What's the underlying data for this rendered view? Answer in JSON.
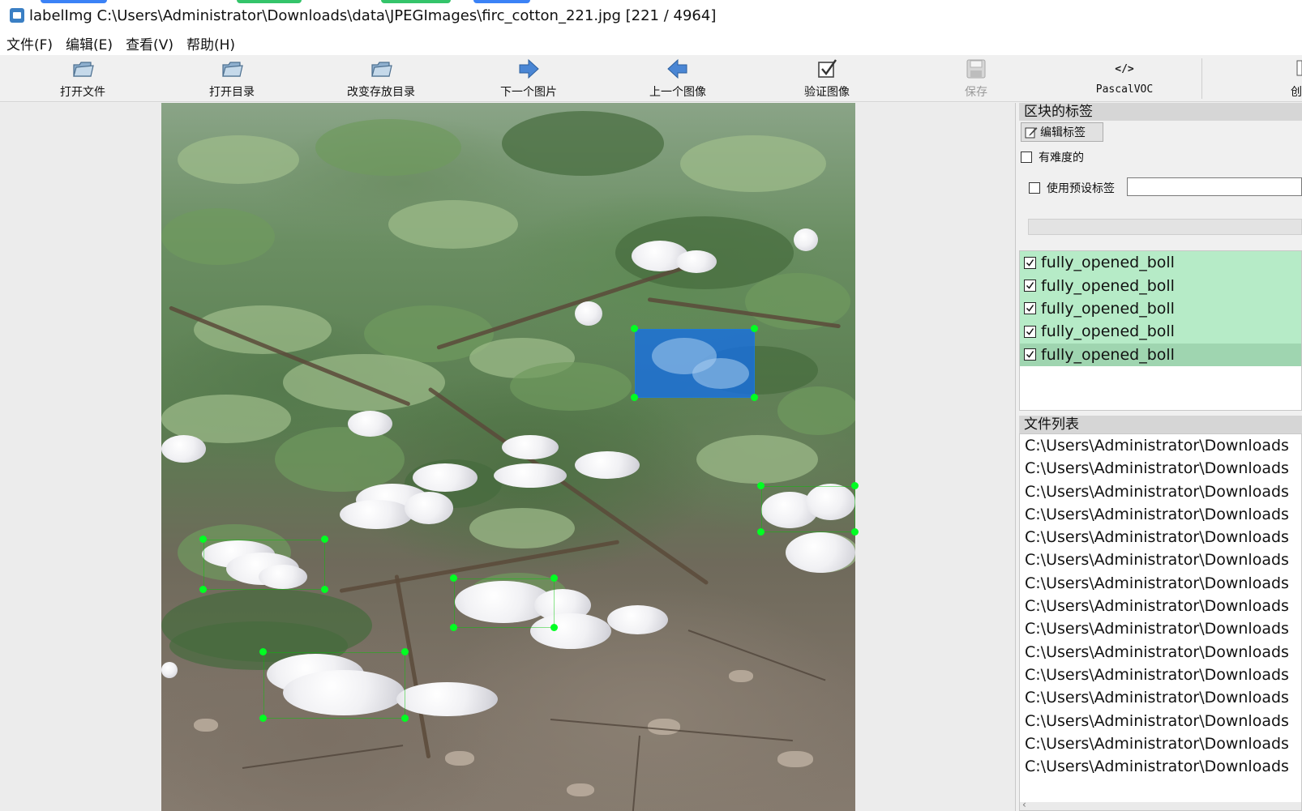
{
  "window": {
    "title": "labelImg C:\\Users\\Administrator\\Downloads\\data\\JPEGImages\\firc_cotton_221.jpg [221 / 4964]",
    "icon": "labelimg-app-icon"
  },
  "menu": {
    "items": [
      "文件(F)",
      "编辑(E)",
      "查看(V)",
      "帮助(H)"
    ]
  },
  "toolbar": {
    "open_file": "打开文件",
    "open_dir": "打开目录",
    "change_save_dir": "改变存放目录",
    "next_image": "下一个图片",
    "prev_image": "上一个图像",
    "verify_image": "验证图像",
    "save": "保存",
    "format_icon": "</>",
    "format": "PascalVOC",
    "create_partial": "创"
  },
  "box_labels_panel": {
    "title": "区块的标签",
    "edit_label_button": "编辑标签",
    "difficult_label": "有难度的",
    "difficult_checked": false,
    "use_default_label": "使用预设标签",
    "use_default_checked": false,
    "default_label_value": "",
    "labels": [
      {
        "text": "fully_opened_boll",
        "checked": true,
        "selected": false
      },
      {
        "text": "fully_opened_boll",
        "checked": true,
        "selected": false
      },
      {
        "text": "fully_opened_boll",
        "checked": true,
        "selected": false
      },
      {
        "text": "fully_opened_boll",
        "checked": true,
        "selected": false
      },
      {
        "text": "fully_opened_boll",
        "checked": true,
        "selected": true
      }
    ]
  },
  "file_list_panel": {
    "title": "文件列表",
    "files": [
      "C:\\Users\\Administrator\\Downloads",
      "C:\\Users\\Administrator\\Downloads",
      "C:\\Users\\Administrator\\Downloads",
      "C:\\Users\\Administrator\\Downloads",
      "C:\\Users\\Administrator\\Downloads",
      "C:\\Users\\Administrator\\Downloads",
      "C:\\Users\\Administrator\\Downloads",
      "C:\\Users\\Administrator\\Downloads",
      "C:\\Users\\Administrator\\Downloads",
      "C:\\Users\\Administrator\\Downloads",
      "C:\\Users\\Administrator\\Downloads",
      "C:\\Users\\Administrator\\Downloads",
      "C:\\Users\\Administrator\\Downloads",
      "C:\\Users\\Administrator\\Downloads",
      "C:\\Users\\Administrator\\Downloads"
    ]
  },
  "colors": {
    "label_row_bg": "#b6ebc7",
    "label_row_selected_bg": "#9fd5b0",
    "selected_box_fill": "#1c6fe0",
    "handle_color": "#00ff22"
  }
}
